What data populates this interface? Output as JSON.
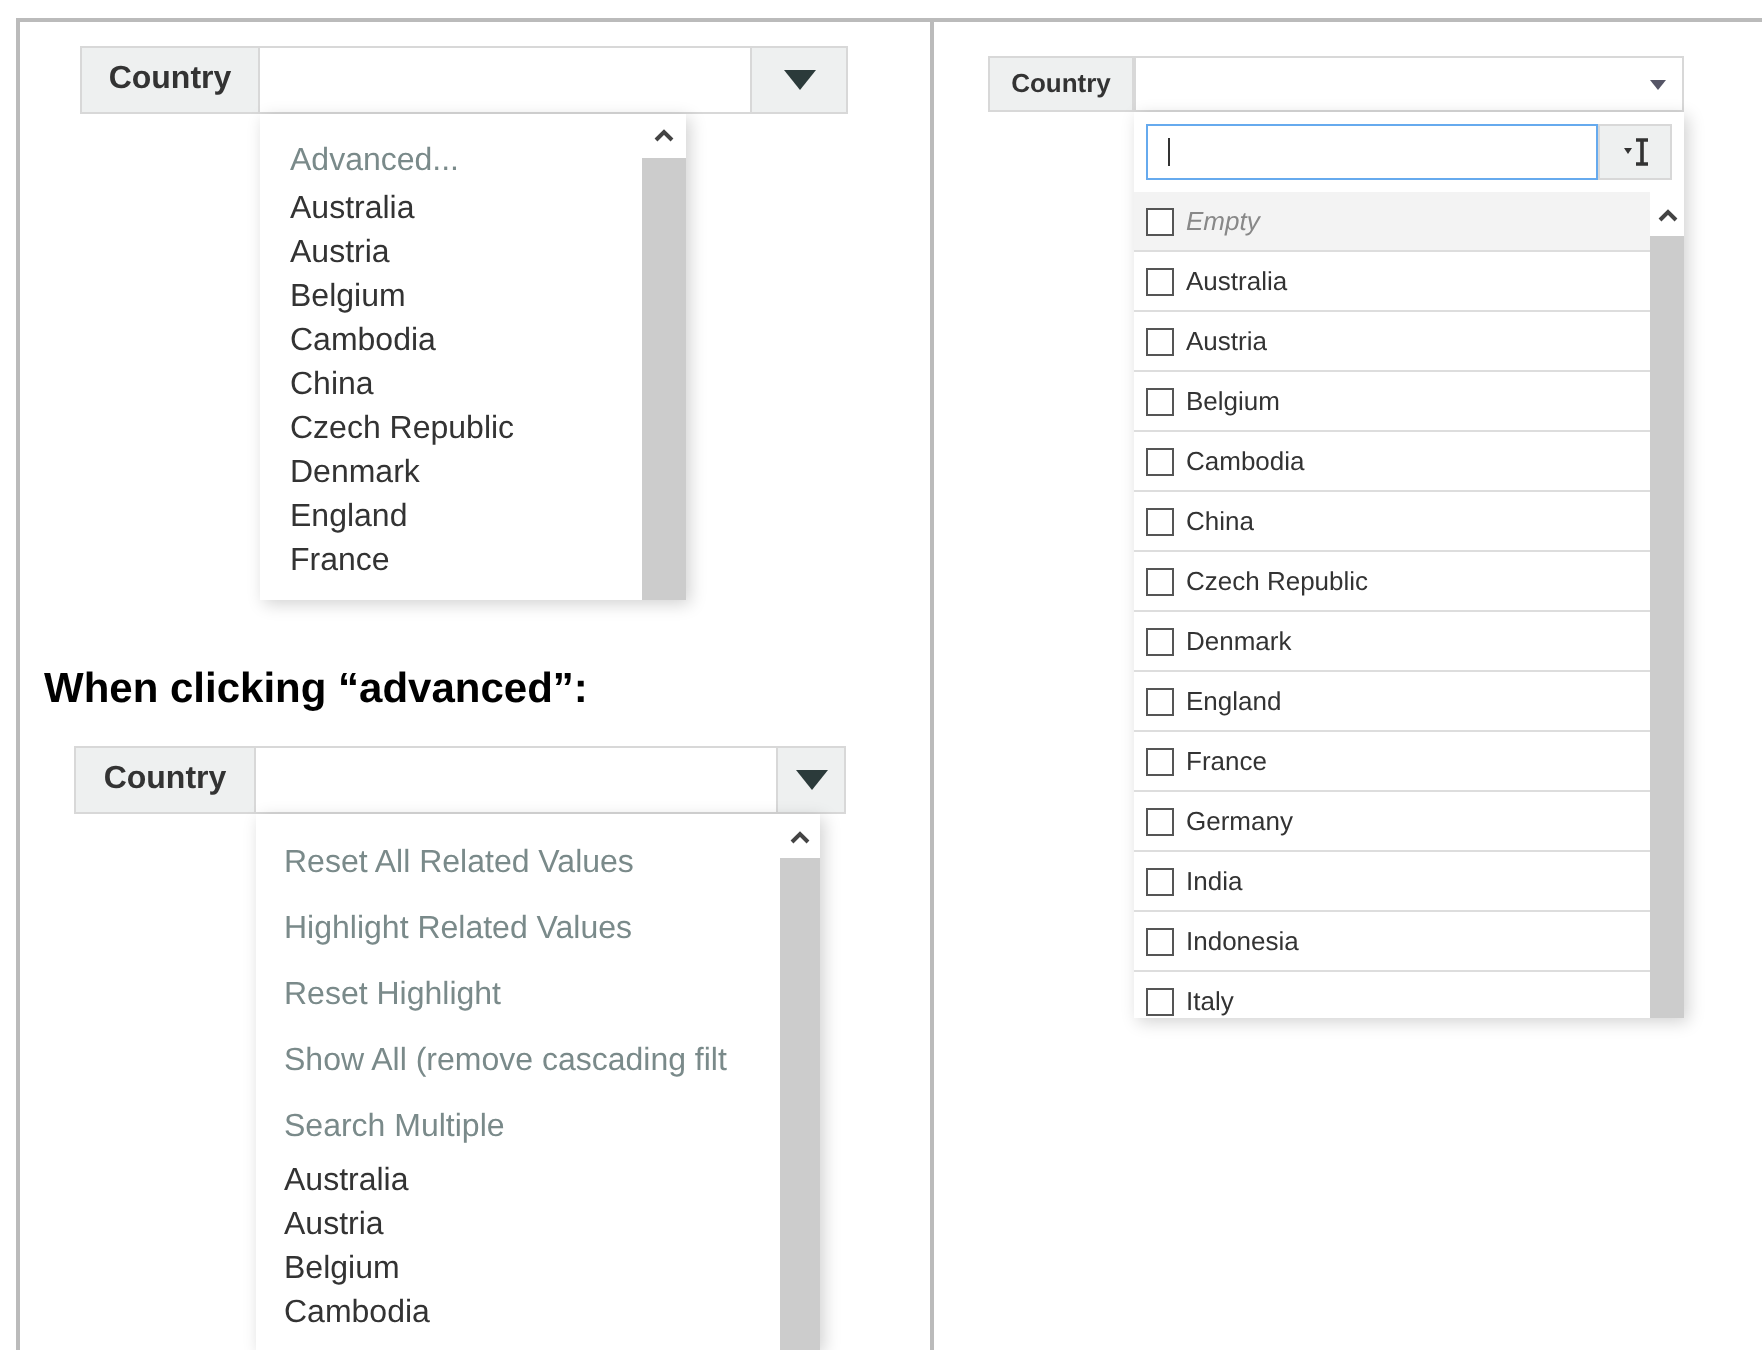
{
  "left_top": {
    "label": "Country",
    "menu": [
      {
        "kind": "action",
        "label": "Advanced..."
      },
      {
        "kind": "option",
        "label": "Australia"
      },
      {
        "kind": "option",
        "label": "Austria"
      },
      {
        "kind": "option",
        "label": "Belgium"
      },
      {
        "kind": "option",
        "label": "Cambodia"
      },
      {
        "kind": "option",
        "label": "China"
      },
      {
        "kind": "option",
        "label": "Czech Republic"
      },
      {
        "kind": "option",
        "label": "Denmark"
      },
      {
        "kind": "option",
        "label": "England"
      },
      {
        "kind": "option",
        "label": "France"
      }
    ]
  },
  "caption": "When clicking “advanced”:",
  "left_bottom": {
    "label": "Country",
    "menu": [
      {
        "kind": "action",
        "label": "Reset All Related Values"
      },
      {
        "kind": "action",
        "label": "Highlight Related Values"
      },
      {
        "kind": "action",
        "label": "Reset Highlight"
      },
      {
        "kind": "action",
        "label": "Show All (remove cascading filt"
      },
      {
        "kind": "action",
        "label": "Search Multiple"
      },
      {
        "kind": "option",
        "label": "Australia"
      },
      {
        "kind": "option",
        "label": "Austria"
      },
      {
        "kind": "option",
        "label": "Belgium"
      },
      {
        "kind": "option",
        "label": "Cambodia"
      }
    ]
  },
  "right": {
    "label": "Country",
    "options": [
      {
        "kind": "empty",
        "label": "Empty",
        "checked": false
      },
      {
        "kind": "option",
        "label": "Australia",
        "checked": false
      },
      {
        "kind": "option",
        "label": "Austria",
        "checked": false
      },
      {
        "kind": "option",
        "label": "Belgium",
        "checked": false
      },
      {
        "kind": "option",
        "label": "Cambodia",
        "checked": false
      },
      {
        "kind": "option",
        "label": "China",
        "checked": false
      },
      {
        "kind": "option",
        "label": "Czech Republic",
        "checked": false
      },
      {
        "kind": "option",
        "label": "Denmark",
        "checked": false
      },
      {
        "kind": "option",
        "label": "England",
        "checked": false
      },
      {
        "kind": "option",
        "label": "France",
        "checked": false
      },
      {
        "kind": "option",
        "label": "Germany",
        "checked": false
      },
      {
        "kind": "option",
        "label": "India",
        "checked": false
      },
      {
        "kind": "option",
        "label": "Indonesia",
        "checked": false
      },
      {
        "kind": "option",
        "label": "Italy",
        "checked": false
      }
    ]
  }
}
